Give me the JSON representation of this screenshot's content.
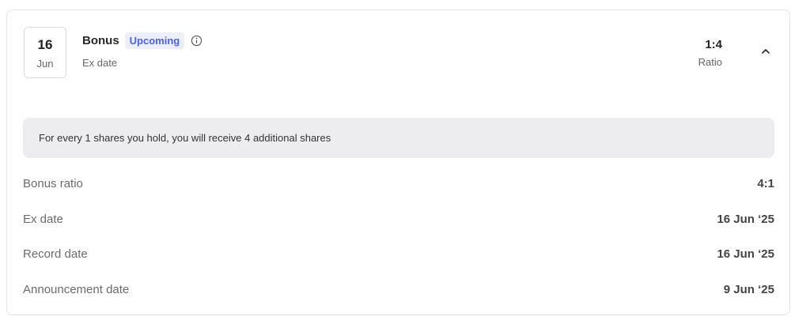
{
  "event": {
    "day": "16",
    "month": "Jun",
    "title": "Bonus",
    "badge": "Upcoming",
    "subtitle": "Ex date",
    "ratio_value": "1:4",
    "ratio_label": "Ratio",
    "icons": {
      "info": "info-icon",
      "toggle": "chevron-up-icon"
    },
    "colors": {
      "badge_bg": "#eceefc",
      "badge_text": "#4a63e6"
    }
  },
  "note": "For every 1 shares you hold, you will receive 4 additional shares",
  "details": [
    {
      "label": "Bonus ratio",
      "value": "4:1"
    },
    {
      "label": "Ex date",
      "value": "16 Jun ‘25"
    },
    {
      "label": "Record date",
      "value": "16 Jun ‘25"
    },
    {
      "label": "Announcement date",
      "value": "9 Jun ‘25"
    }
  ]
}
